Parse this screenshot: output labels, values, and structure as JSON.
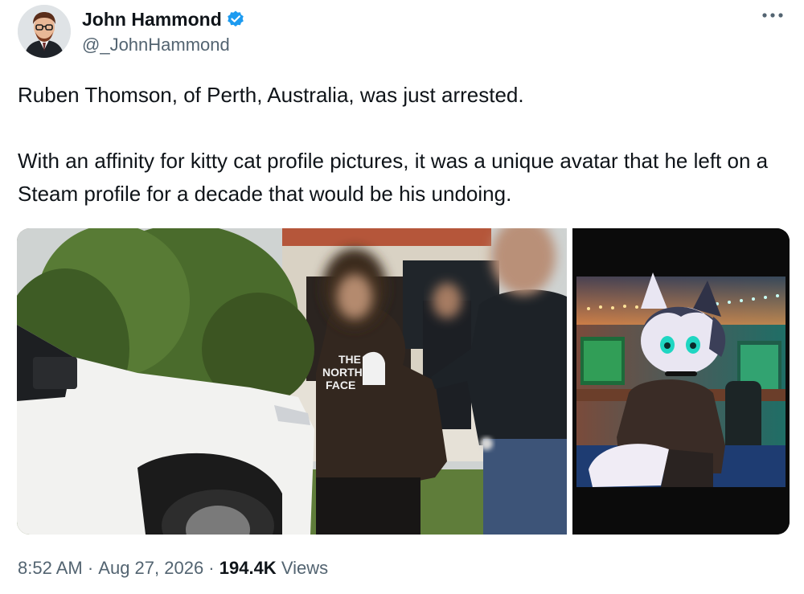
{
  "author": {
    "display_name": "John Hammond",
    "handle": "@_JohnHammond",
    "verified": true,
    "verified_color": "#1d9bf0"
  },
  "tweet": {
    "paragraphs": [
      "Ruben Thomson, of Perth, Australia, was just arrested.",
      "With an affinity for kitty cat profile pictures, it was a unique avatar that he left on a Steam profile for a decade that would be his undoing."
    ]
  },
  "media": {
    "photo1": {
      "hoodie_text_1": "THE",
      "hoodie_text_2": "NORTH",
      "hoodie_text_3": "FACE"
    }
  },
  "footer": {
    "time": "8:52 AM",
    "separator": " · ",
    "date": "Aug 27, 2026",
    "views_count": "194.4K",
    "views_label": " Views"
  },
  "icons": {
    "more": "more-options-icon",
    "verified": "verified-badge-icon"
  }
}
